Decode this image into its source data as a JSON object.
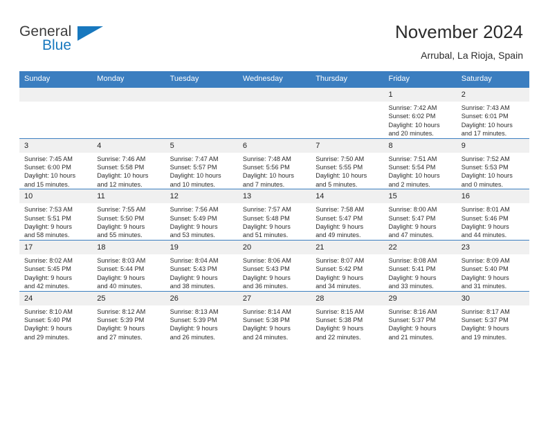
{
  "brand": {
    "name_part1": "General",
    "name_part2": "Blue",
    "accent_color": "#1878be"
  },
  "header": {
    "title": "November 2024",
    "subtitle": "Arrubal, La Rioja, Spain",
    "header_bg_color": "#3b7ec0",
    "daynum_bg_color": "#f0f0f0"
  },
  "weekdays": [
    "Sunday",
    "Monday",
    "Tuesday",
    "Wednesday",
    "Thursday",
    "Friday",
    "Saturday"
  ],
  "labels": {
    "sunrise_prefix": "Sunrise:",
    "sunset_prefix": "Sunset:",
    "daylight_prefix": "Daylight:"
  },
  "weeks": [
    [
      {
        "day": "",
        "empty": true,
        "sunrise": "",
        "sunset": "",
        "daylight_l1": "",
        "daylight_l2": ""
      },
      {
        "day": "",
        "empty": true,
        "sunrise": "",
        "sunset": "",
        "daylight_l1": "",
        "daylight_l2": ""
      },
      {
        "day": "",
        "empty": true,
        "sunrise": "",
        "sunset": "",
        "daylight_l1": "",
        "daylight_l2": ""
      },
      {
        "day": "",
        "empty": true,
        "sunrise": "",
        "sunset": "",
        "daylight_l1": "",
        "daylight_l2": ""
      },
      {
        "day": "",
        "empty": true,
        "sunrise": "",
        "sunset": "",
        "daylight_l1": "",
        "daylight_l2": ""
      },
      {
        "day": "1",
        "sunrise": "Sunrise: 7:42 AM",
        "sunset": "Sunset: 6:02 PM",
        "daylight_l1": "Daylight: 10 hours",
        "daylight_l2": "and 20 minutes."
      },
      {
        "day": "2",
        "sunrise": "Sunrise: 7:43 AM",
        "sunset": "Sunset: 6:01 PM",
        "daylight_l1": "Daylight: 10 hours",
        "daylight_l2": "and 17 minutes."
      }
    ],
    [
      {
        "day": "3",
        "sunrise": "Sunrise: 7:45 AM",
        "sunset": "Sunset: 6:00 PM",
        "daylight_l1": "Daylight: 10 hours",
        "daylight_l2": "and 15 minutes."
      },
      {
        "day": "4",
        "sunrise": "Sunrise: 7:46 AM",
        "sunset": "Sunset: 5:58 PM",
        "daylight_l1": "Daylight: 10 hours",
        "daylight_l2": "and 12 minutes."
      },
      {
        "day": "5",
        "sunrise": "Sunrise: 7:47 AM",
        "sunset": "Sunset: 5:57 PM",
        "daylight_l1": "Daylight: 10 hours",
        "daylight_l2": "and 10 minutes."
      },
      {
        "day": "6",
        "sunrise": "Sunrise: 7:48 AM",
        "sunset": "Sunset: 5:56 PM",
        "daylight_l1": "Daylight: 10 hours",
        "daylight_l2": "and 7 minutes."
      },
      {
        "day": "7",
        "sunrise": "Sunrise: 7:50 AM",
        "sunset": "Sunset: 5:55 PM",
        "daylight_l1": "Daylight: 10 hours",
        "daylight_l2": "and 5 minutes."
      },
      {
        "day": "8",
        "sunrise": "Sunrise: 7:51 AM",
        "sunset": "Sunset: 5:54 PM",
        "daylight_l1": "Daylight: 10 hours",
        "daylight_l2": "and 2 minutes."
      },
      {
        "day": "9",
        "sunrise": "Sunrise: 7:52 AM",
        "sunset": "Sunset: 5:53 PM",
        "daylight_l1": "Daylight: 10 hours",
        "daylight_l2": "and 0 minutes."
      }
    ],
    [
      {
        "day": "10",
        "sunrise": "Sunrise: 7:53 AM",
        "sunset": "Sunset: 5:51 PM",
        "daylight_l1": "Daylight: 9 hours",
        "daylight_l2": "and 58 minutes."
      },
      {
        "day": "11",
        "sunrise": "Sunrise: 7:55 AM",
        "sunset": "Sunset: 5:50 PM",
        "daylight_l1": "Daylight: 9 hours",
        "daylight_l2": "and 55 minutes."
      },
      {
        "day": "12",
        "sunrise": "Sunrise: 7:56 AM",
        "sunset": "Sunset: 5:49 PM",
        "daylight_l1": "Daylight: 9 hours",
        "daylight_l2": "and 53 minutes."
      },
      {
        "day": "13",
        "sunrise": "Sunrise: 7:57 AM",
        "sunset": "Sunset: 5:48 PM",
        "daylight_l1": "Daylight: 9 hours",
        "daylight_l2": "and 51 minutes."
      },
      {
        "day": "14",
        "sunrise": "Sunrise: 7:58 AM",
        "sunset": "Sunset: 5:47 PM",
        "daylight_l1": "Daylight: 9 hours",
        "daylight_l2": "and 49 minutes."
      },
      {
        "day": "15",
        "sunrise": "Sunrise: 8:00 AM",
        "sunset": "Sunset: 5:47 PM",
        "daylight_l1": "Daylight: 9 hours",
        "daylight_l2": "and 47 minutes."
      },
      {
        "day": "16",
        "sunrise": "Sunrise: 8:01 AM",
        "sunset": "Sunset: 5:46 PM",
        "daylight_l1": "Daylight: 9 hours",
        "daylight_l2": "and 44 minutes."
      }
    ],
    [
      {
        "day": "17",
        "sunrise": "Sunrise: 8:02 AM",
        "sunset": "Sunset: 5:45 PM",
        "daylight_l1": "Daylight: 9 hours",
        "daylight_l2": "and 42 minutes."
      },
      {
        "day": "18",
        "sunrise": "Sunrise: 8:03 AM",
        "sunset": "Sunset: 5:44 PM",
        "daylight_l1": "Daylight: 9 hours",
        "daylight_l2": "and 40 minutes."
      },
      {
        "day": "19",
        "sunrise": "Sunrise: 8:04 AM",
        "sunset": "Sunset: 5:43 PM",
        "daylight_l1": "Daylight: 9 hours",
        "daylight_l2": "and 38 minutes."
      },
      {
        "day": "20",
        "sunrise": "Sunrise: 8:06 AM",
        "sunset": "Sunset: 5:43 PM",
        "daylight_l1": "Daylight: 9 hours",
        "daylight_l2": "and 36 minutes."
      },
      {
        "day": "21",
        "sunrise": "Sunrise: 8:07 AM",
        "sunset": "Sunset: 5:42 PM",
        "daylight_l1": "Daylight: 9 hours",
        "daylight_l2": "and 34 minutes."
      },
      {
        "day": "22",
        "sunrise": "Sunrise: 8:08 AM",
        "sunset": "Sunset: 5:41 PM",
        "daylight_l1": "Daylight: 9 hours",
        "daylight_l2": "and 33 minutes."
      },
      {
        "day": "23",
        "sunrise": "Sunrise: 8:09 AM",
        "sunset": "Sunset: 5:40 PM",
        "daylight_l1": "Daylight: 9 hours",
        "daylight_l2": "and 31 minutes."
      }
    ],
    [
      {
        "day": "24",
        "sunrise": "Sunrise: 8:10 AM",
        "sunset": "Sunset: 5:40 PM",
        "daylight_l1": "Daylight: 9 hours",
        "daylight_l2": "and 29 minutes."
      },
      {
        "day": "25",
        "sunrise": "Sunrise: 8:12 AM",
        "sunset": "Sunset: 5:39 PM",
        "daylight_l1": "Daylight: 9 hours",
        "daylight_l2": "and 27 minutes."
      },
      {
        "day": "26",
        "sunrise": "Sunrise: 8:13 AM",
        "sunset": "Sunset: 5:39 PM",
        "daylight_l1": "Daylight: 9 hours",
        "daylight_l2": "and 26 minutes."
      },
      {
        "day": "27",
        "sunrise": "Sunrise: 8:14 AM",
        "sunset": "Sunset: 5:38 PM",
        "daylight_l1": "Daylight: 9 hours",
        "daylight_l2": "and 24 minutes."
      },
      {
        "day": "28",
        "sunrise": "Sunrise: 8:15 AM",
        "sunset": "Sunset: 5:38 PM",
        "daylight_l1": "Daylight: 9 hours",
        "daylight_l2": "and 22 minutes."
      },
      {
        "day": "29",
        "sunrise": "Sunrise: 8:16 AM",
        "sunset": "Sunset: 5:37 PM",
        "daylight_l1": "Daylight: 9 hours",
        "daylight_l2": "and 21 minutes."
      },
      {
        "day": "30",
        "sunrise": "Sunrise: 8:17 AM",
        "sunset": "Sunset: 5:37 PM",
        "daylight_l1": "Daylight: 9 hours",
        "daylight_l2": "and 19 minutes."
      }
    ]
  ]
}
